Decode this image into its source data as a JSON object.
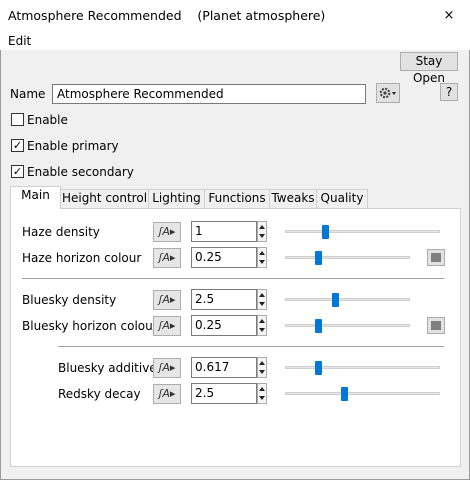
{
  "window": {
    "title": "Atmosphere Recommended    (Planet atmosphere)",
    "close_glyph": "×"
  },
  "menu": {
    "edit": "Edit"
  },
  "toolbar": {
    "stay_open": "Stay Open",
    "help": "?",
    "gear_icon": "gear-icon"
  },
  "name": {
    "label": "Name",
    "value": "Atmosphere Recommended"
  },
  "checkboxes": [
    {
      "label": "Enable",
      "checked": false
    },
    {
      "label": "Enable primary",
      "checked": true
    },
    {
      "label": "Enable secondary",
      "checked": true
    }
  ],
  "tabs": [
    "Main",
    "Height control",
    "Lighting",
    "Functions",
    "Tweaks",
    "Quality"
  ],
  "active_tab": "Main",
  "rows": [
    {
      "label": "Haze density",
      "value": "1",
      "slider": 0.25,
      "color_swatch": false
    },
    {
      "label": "Haze horizon colour",
      "value": "0.25",
      "slider": 0.25,
      "color_swatch": true
    },
    {
      "label": "Bluesky density",
      "value": "2.5",
      "slider": 0.4,
      "color_swatch": false
    },
    {
      "label": "Bluesky horizon colour",
      "value": "0.25",
      "slider": 0.25,
      "color_swatch": true
    },
    {
      "label": "Bluesky additive",
      "value": "0.617",
      "slider": 0.2,
      "color_swatch": false
    },
    {
      "label": "Redsky decay",
      "value": "2.5",
      "slider": 0.38,
      "color_swatch": false
    }
  ],
  "colors": {
    "slider_thumb": "#0078d7",
    "swatch_fill": "#808080",
    "panel_bg": "#ffffff",
    "window_bg": "#f0f0f0"
  }
}
